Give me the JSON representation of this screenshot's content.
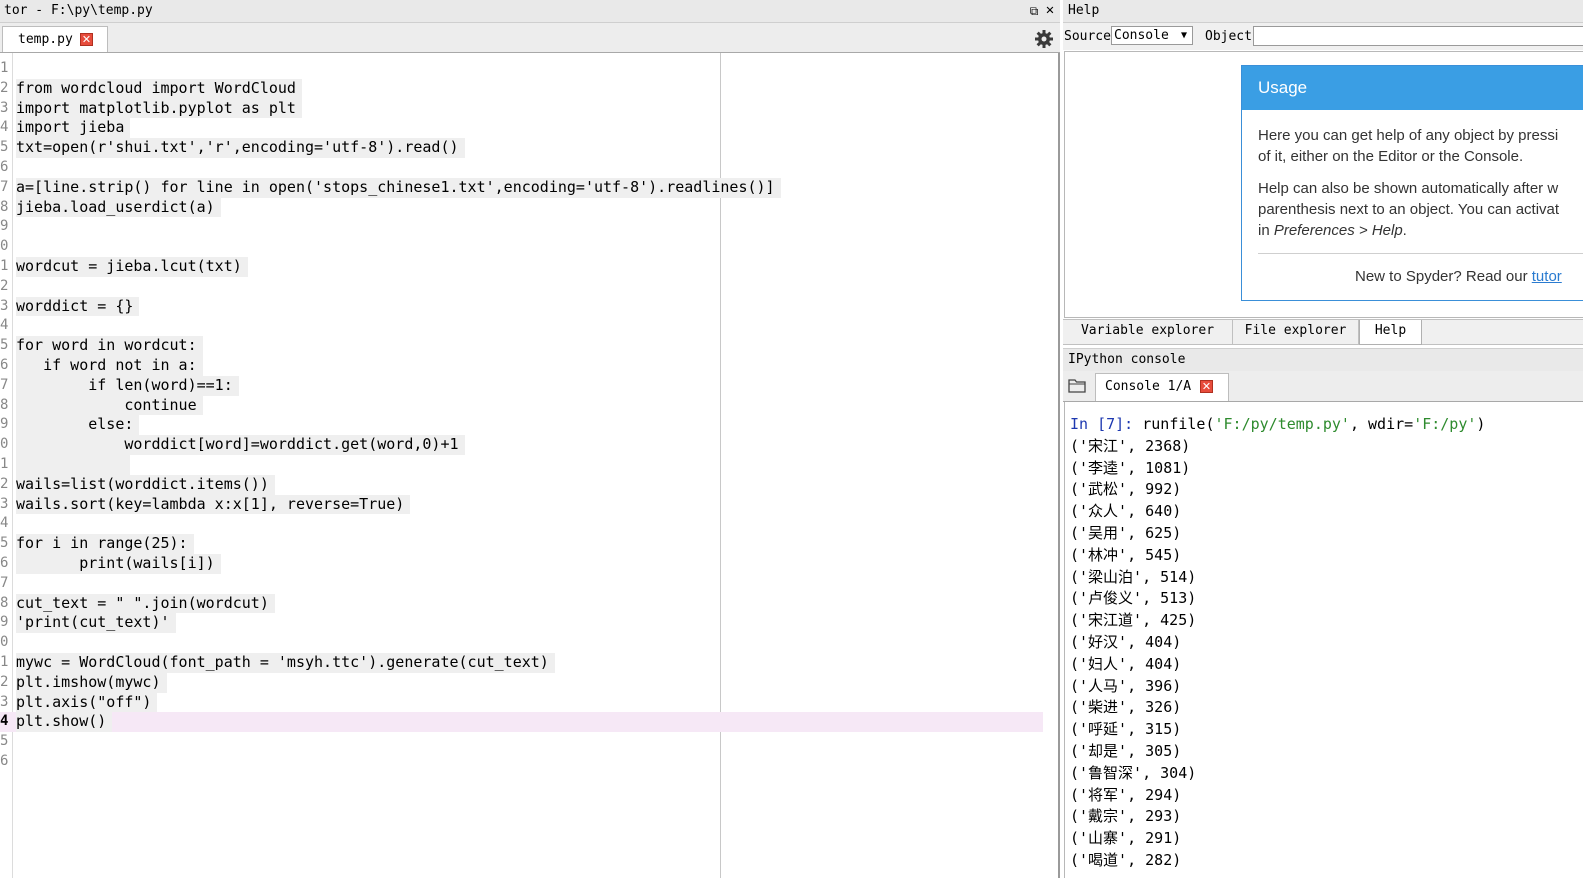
{
  "editor": {
    "title": "tor - F:\\py\\temp.py",
    "tab_label": "temp.py",
    "lines": [
      {
        "num": "1",
        "text": ""
      },
      {
        "num": "2",
        "text": "from wordcloud import WordCloud"
      },
      {
        "num": "3",
        "text": "import matplotlib.pyplot as plt"
      },
      {
        "num": "4",
        "text": "import jieba"
      },
      {
        "num": "5",
        "text": "txt=open(r'shui.txt','r',encoding='utf-8').read()"
      },
      {
        "num": "6",
        "text": ""
      },
      {
        "num": "7",
        "text": "a=[line.strip() for line in open('stops_chinese1.txt',encoding='utf-8').readlines()]"
      },
      {
        "num": "8",
        "text": "jieba.load_userdict(a)"
      },
      {
        "num": "9",
        "text": ""
      },
      {
        "num": "0",
        "text": ""
      },
      {
        "num": "1",
        "text": "wordcut = jieba.lcut(txt)"
      },
      {
        "num": "2",
        "text": ""
      },
      {
        "num": "3",
        "text": "worddict = {}"
      },
      {
        "num": "4",
        "text": ""
      },
      {
        "num": "5",
        "text": "for word in wordcut:"
      },
      {
        "num": "6",
        "text": "   if word not in a:"
      },
      {
        "num": "7",
        "text": "        if len(word)==1:"
      },
      {
        "num": "8",
        "text": "            continue"
      },
      {
        "num": "9",
        "text": "        else:"
      },
      {
        "num": "0",
        "text": "            worddict[word]=worddict.get(word,0)+1"
      },
      {
        "num": "1",
        "text": "            "
      },
      {
        "num": "2",
        "text": "wails=list(worddict.items())"
      },
      {
        "num": "3",
        "text": "wails.sort(key=lambda x:x[1], reverse=True)"
      },
      {
        "num": "4",
        "text": ""
      },
      {
        "num": "5",
        "text": "for i in range(25):"
      },
      {
        "num": "6",
        "text": "       print(wails[i])"
      },
      {
        "num": "7",
        "text": ""
      },
      {
        "num": "8",
        "text": "cut_text = \" \".join(wordcut)"
      },
      {
        "num": "9",
        "text": "'print(cut_text)'"
      },
      {
        "num": "0",
        "text": ""
      },
      {
        "num": "1",
        "text": "mywc = WordCloud(font_path = 'msyh.ttc').generate(cut_text)"
      },
      {
        "num": "2",
        "text": "plt.imshow(mywc)"
      },
      {
        "num": "3",
        "text": "plt.axis(\"off\")"
      },
      {
        "num": "4",
        "text": "plt.show()"
      },
      {
        "num": "5",
        "text": ""
      },
      {
        "num": "6",
        "text": ""
      }
    ],
    "current_line_index": 33
  },
  "help": {
    "title": "Help",
    "source_label": "Source",
    "source_value": "Console",
    "object_label": "Object",
    "object_value": "",
    "usage_title": "Usage",
    "usage_p1_l1": "Here you can get help of any object by pressi",
    "usage_p1_l2": "of it, either on the Editor or the Console.",
    "usage_p2_l1": "Help can also be shown automatically after w",
    "usage_p2_l2": "parenthesis next to an object. You can activat",
    "usage_p2_l3_pre": "in ",
    "usage_p2_l3_em": "Preferences > Help",
    "usage_p2_l3_post": ".",
    "usage_new_text": "New to Spyder? Read our ",
    "usage_link": "tutor"
  },
  "tabs": {
    "variable_explorer": "Variable explorer",
    "file_explorer": "File explorer",
    "help": "Help"
  },
  "console": {
    "title": "IPython console",
    "tab_label": "Console 1/A",
    "prompt": "In [7]:",
    "command_pre": " runfile(",
    "arg1": "'F:/py/temp.py'",
    "command_mid": ", wdir=",
    "arg2": "'F:/py'",
    "command_post": ")",
    "output": [
      "('宋江', 2368)",
      "('李逵', 1081)",
      "('武松', 992)",
      "('众人', 640)",
      "('吴用', 625)",
      "('林冲', 545)",
      "('梁山泊', 514)",
      "('卢俊义', 513)",
      "('宋江道', 425)",
      "('好汉', 404)",
      "('妇人', 404)",
      "('人马', 396)",
      "('柴进', 326)",
      "('呼延', 315)",
      "('却是', 305)",
      "('鲁智深', 304)",
      "('将军', 294)",
      "('戴宗', 293)",
      "('山寨', 291)",
      "('喝道', 282)"
    ]
  }
}
